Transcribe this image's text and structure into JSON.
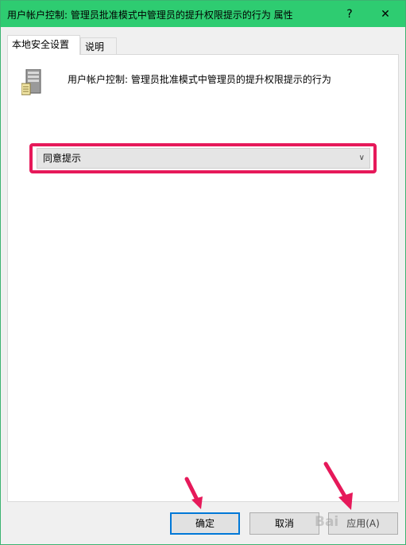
{
  "window": {
    "title": "用户帐户控制: 管理员批准模式中管理员的提升权限提示的行为 属性",
    "help_glyph": "?",
    "close_glyph": "✕"
  },
  "tabs": [
    {
      "label": "本地安全设置",
      "active": true
    },
    {
      "label": "说明",
      "active": false
    }
  ],
  "policy": {
    "description": "用户帐户控制: 管理员批准模式中管理员的提升权限提示的行为",
    "selected_value": "同意提示",
    "icon": "server-icon"
  },
  "buttons": {
    "ok": "确定",
    "cancel": "取消",
    "apply": "应用(A)"
  },
  "colors": {
    "titlebar": "#2ecc71",
    "highlight": "#e6195a",
    "arrow": "#e6195a",
    "focus": "#0078d7"
  },
  "watermark": "Bai"
}
